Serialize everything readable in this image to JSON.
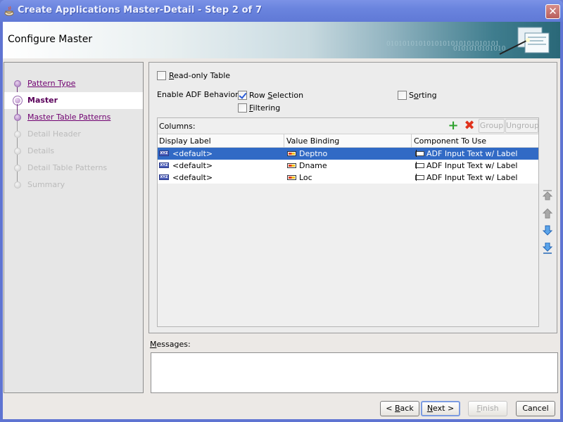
{
  "window": {
    "title": "Create Applications Master-Detail - Step 2 of 7",
    "close_label": "✕"
  },
  "header": {
    "title": "Configure Master",
    "binary_text_1": "0101010101010101010101010101",
    "binary_text_2": "0101010101010"
  },
  "steps": [
    {
      "label": "Pattern Type",
      "state": "done"
    },
    {
      "label": "Master",
      "state": "current"
    },
    {
      "label": "Master Table Patterns",
      "state": "done"
    },
    {
      "label": "Detail Header",
      "state": "pending"
    },
    {
      "label": "Details",
      "state": "pending"
    },
    {
      "label": "Detail Table Patterns",
      "state": "pending"
    },
    {
      "label": "Summary",
      "state": "pending"
    }
  ],
  "options": {
    "read_only_table": {
      "pre": "",
      "mnemonic": "R",
      "post": "ead-only Table",
      "checked": false
    },
    "enable_adf_label": "Enable ADF Behavior:",
    "row_selection": {
      "pre": "Row ",
      "mnemonic": "S",
      "post": "election",
      "checked": true
    },
    "filtering": {
      "pre": "",
      "mnemonic": "F",
      "post": "iltering",
      "checked": false
    },
    "sorting": {
      "pre": "S",
      "mnemonic": "o",
      "post": "rting",
      "checked": false
    }
  },
  "columns": {
    "label": "Columns:",
    "add_icon": "+",
    "remove_icon": "✖",
    "group_label": "Group",
    "ungroup_label": "Ungroup",
    "headers": [
      "Display Label",
      "Value Binding",
      "Component To Use"
    ],
    "rows": [
      {
        "display_label": "<default>",
        "value_binding": "Deptno",
        "component": "ADF Input Text w/ Label",
        "selected": true
      },
      {
        "display_label": "<default>",
        "value_binding": "Dname",
        "component": "ADF Input Text w/ Label",
        "selected": false
      },
      {
        "display_label": "<default>",
        "value_binding": "Loc",
        "component": "ADF Input Text w/ Label",
        "selected": false
      }
    ]
  },
  "messages": {
    "mnemonic": "M",
    "post": "essages:",
    "content": ""
  },
  "buttons": {
    "back": {
      "pre": "< ",
      "mnemonic": "B",
      "post": "ack"
    },
    "next": {
      "pre": "",
      "mnemonic": "N",
      "post": "ext >"
    },
    "finish": {
      "pre": "",
      "mnemonic": "F",
      "post": "inish"
    },
    "cancel": {
      "label": "Cancel"
    }
  },
  "colors": {
    "title_bar": "#6a84de",
    "selection": "#316ac5",
    "step_done": "#700070"
  }
}
